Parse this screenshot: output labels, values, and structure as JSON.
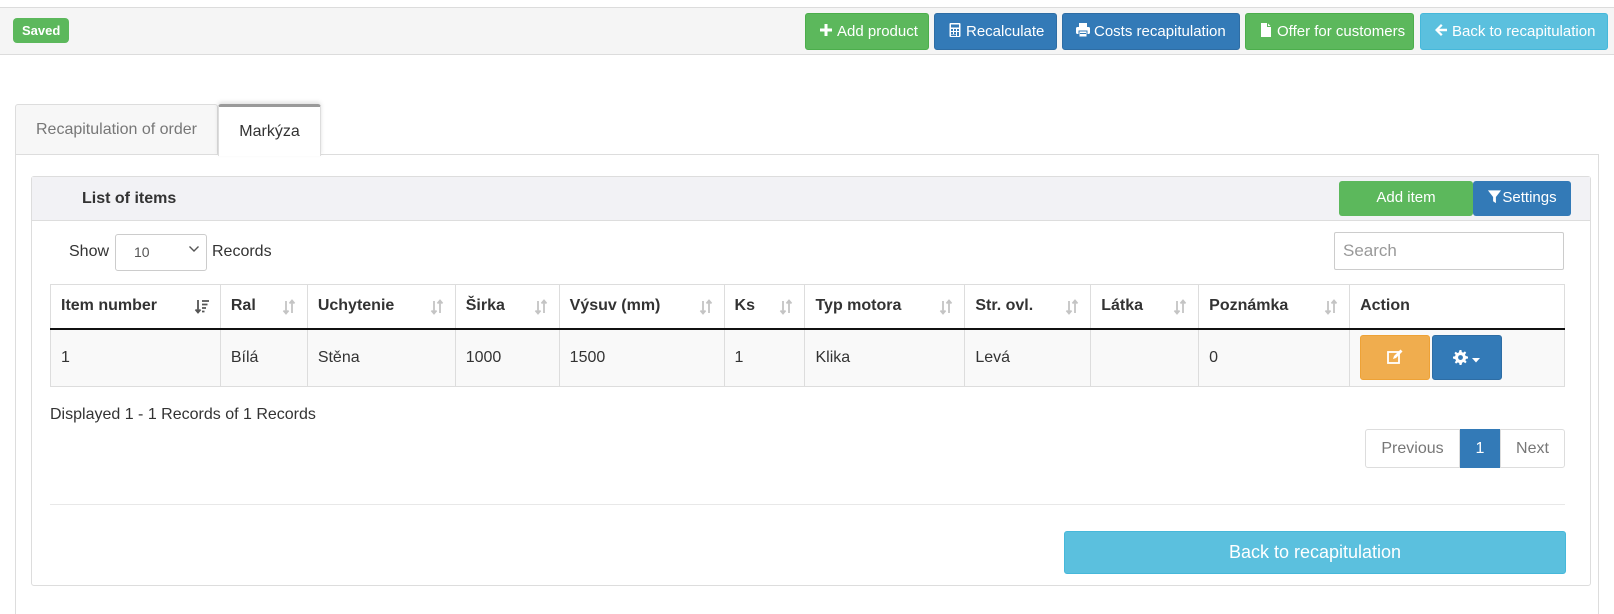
{
  "toolbar": {
    "status_badge": "Saved",
    "buttons": {
      "add_product": "Add product",
      "recalculate": "Recalculate",
      "costs_recapitulation": "Costs recapitulation",
      "offer_for_customers": "Offer for customers",
      "back_to_recapitulation": "Back to recapitulation"
    }
  },
  "tabs": [
    {
      "label": "Recapitulation of order",
      "active": false
    },
    {
      "label": "Markýza",
      "active": true
    }
  ],
  "panel": {
    "title": "List of items",
    "add_item": "Add item",
    "settings": "Settings"
  },
  "list_controls": {
    "show_label": "Show",
    "page_size": "10",
    "records_label": "Records",
    "search_placeholder": "Search"
  },
  "table": {
    "columns": [
      "Item number",
      "Ral",
      "Uchytenie",
      "Širka",
      "Výsuv (mm)",
      "Ks",
      "Typ motora",
      "Str. ovl.",
      "Látka",
      "Poznámka",
      "Action"
    ],
    "rows": [
      [
        "1",
        "Bílá",
        "Stěna",
        "1000",
        "1500",
        "1",
        "Klika",
        "Levá",
        "",
        "0"
      ]
    ]
  },
  "footer": {
    "displayed": "Displayed 1 - 1 Records of 1 Records",
    "pagination": {
      "previous": "Previous",
      "current": "1",
      "next": "Next"
    },
    "back_button": "Back to recapitulation"
  },
  "colors": {
    "green": "#5cb85c",
    "blue": "#337ab7",
    "cyan": "#5bc0de",
    "orange": "#f0ad4e"
  }
}
